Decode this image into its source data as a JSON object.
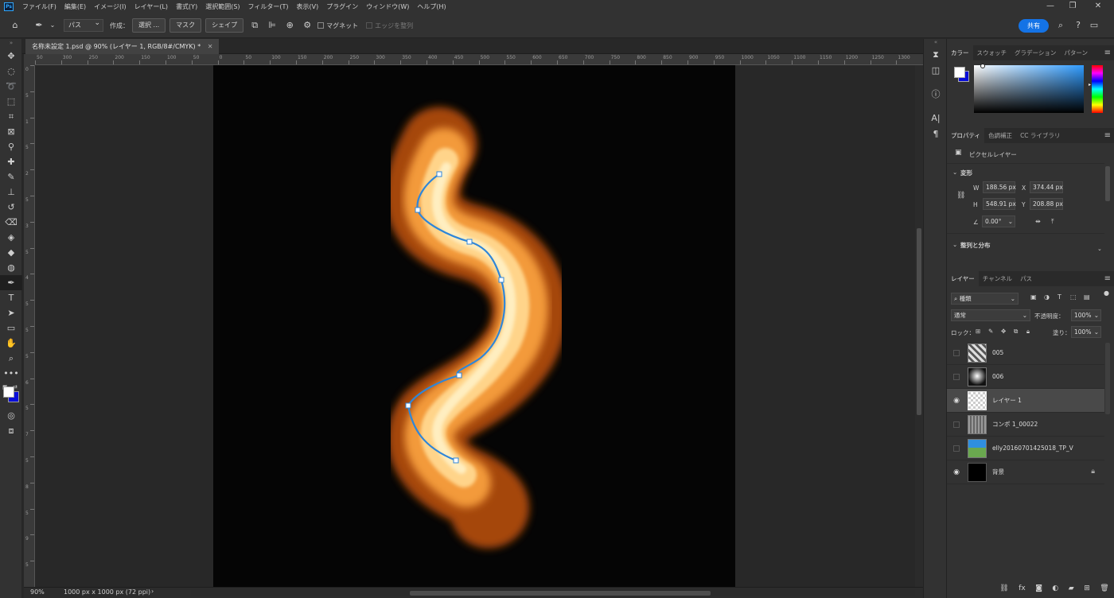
{
  "app": {
    "logo": "Ps",
    "menu": [
      "ファイル(F)",
      "編集(E)",
      "イメージ(I)",
      "レイヤー(L)",
      "書式(Y)",
      "選択範囲(S)",
      "フィルター(T)",
      "表示(V)",
      "プラグイン",
      "ウィンドウ(W)",
      "ヘルプ(H)"
    ],
    "window_controls": [
      "—",
      "❐",
      "✕"
    ]
  },
  "options_bar": {
    "tool_mode": "パス",
    "make_label": "作成：",
    "selection_button": "選択 ...",
    "mask_button": "マスク",
    "shape_button": "シェイプ",
    "magnet_label": "マグネット",
    "align_edges_label": "エッジを整列",
    "share_button": "共有"
  },
  "document": {
    "tab_title": "名称未設定 1.psd @ 90% (レイヤー 1, RGB/8#/CMYK) *",
    "zoom": "90%",
    "doc_size": "1000 px x 1000 px (72 ppi)",
    "h_ruler_ticks": [
      "50",
      "300",
      "250",
      "200",
      "150",
      "100",
      "50",
      "0",
      "50",
      "100",
      "150",
      "200",
      "250",
      "300",
      "350",
      "400",
      "450",
      "500",
      "550",
      "600",
      "650",
      "700",
      "750",
      "800",
      "850",
      "900",
      "950",
      "1000",
      "1050",
      "1100",
      "1150",
      "1200",
      "1250",
      "1300"
    ],
    "v_ruler_ticks": [
      "0",
      "5",
      "1",
      "5",
      "2",
      "5",
      "3",
      "5",
      "4",
      "5",
      "5",
      "5",
      "6",
      "5",
      "7",
      "5",
      "8",
      "5",
      "9",
      "5"
    ]
  },
  "color_panel": {
    "tabs": [
      "カラー",
      "スウォッチ",
      "グラデーション",
      "パターン"
    ],
    "foreground": "#ffffff",
    "background": "#0a0fd8"
  },
  "properties_panel": {
    "tabs": [
      "プロパティ",
      "色調補正",
      "CC ライブラリ"
    ],
    "layer_type": "ピクセルレイヤー",
    "transform_section": "変形",
    "w_label": "W",
    "w": "188.56 px",
    "x_label": "X",
    "x": "374.44 px",
    "h_label": "H",
    "h": "548.91 px",
    "y_label": "Y",
    "y": "208.88 px",
    "angle": "0.00°",
    "align_section": "整列と分布"
  },
  "layers_panel": {
    "tabs": [
      "レイヤー",
      "チャンネル",
      "パス"
    ],
    "filter_kind": "種類",
    "blend_mode": "通常",
    "opacity_label": "不透明度：",
    "opacity": "100%",
    "lock_label": "ロック：",
    "fill_label": "塗り：",
    "fill": "100%",
    "layers": [
      {
        "name": "005",
        "visible": false,
        "selected": false,
        "locked": false
      },
      {
        "name": "006",
        "visible": false,
        "selected": false,
        "locked": false
      },
      {
        "name": "レイヤー 1",
        "visible": true,
        "selected": true,
        "locked": false
      },
      {
        "name": "コンポ 1_00022",
        "visible": false,
        "selected": false,
        "locked": false
      },
      {
        "name": "elly20160701425018_TP_V",
        "visible": false,
        "selected": false,
        "locked": false
      },
      {
        "name": "背景",
        "visible": true,
        "selected": false,
        "locked": true
      }
    ]
  },
  "accent_colors": {
    "share": "#1473e6",
    "path": "#2f86d8"
  }
}
